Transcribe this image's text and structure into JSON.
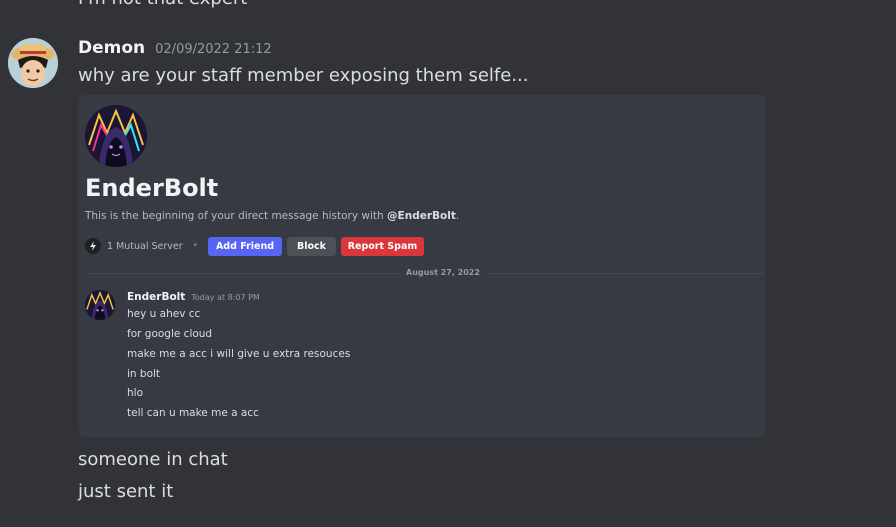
{
  "previous_message": {
    "text": "I'm not that expert"
  },
  "message": {
    "author": "Demon",
    "timestamp": "02/09/2022 21:12",
    "text": "why are your staff member exposing them selfe..."
  },
  "embed": {
    "dm_username": "EnderBolt",
    "intro_prefix": "This is the beginning of your direct message history with ",
    "intro_mention": "@EnderBolt",
    "intro_suffix": ".",
    "mutual_server": "1 Mutual Server",
    "buttons": {
      "add_friend": "Add Friend",
      "block": "Block",
      "report_spam": "Report Spam"
    },
    "date_divider": "August 27, 2022",
    "inner_message": {
      "author": "EnderBolt",
      "timestamp": "Today at 8:07 PM",
      "lines": [
        "hey u ahev cc",
        "for google cloud",
        "make me a acc i will give u extra resouces",
        "in bolt",
        "hlo",
        "tell can u make me a acc"
      ]
    }
  },
  "followups": [
    "someone in chat",
    "just sent it"
  ],
  "colors": {
    "background": "#313338",
    "embed_background": "#373a42",
    "add_friend": "#5865f2",
    "block": "#4e5058",
    "report_spam": "#da373c"
  }
}
